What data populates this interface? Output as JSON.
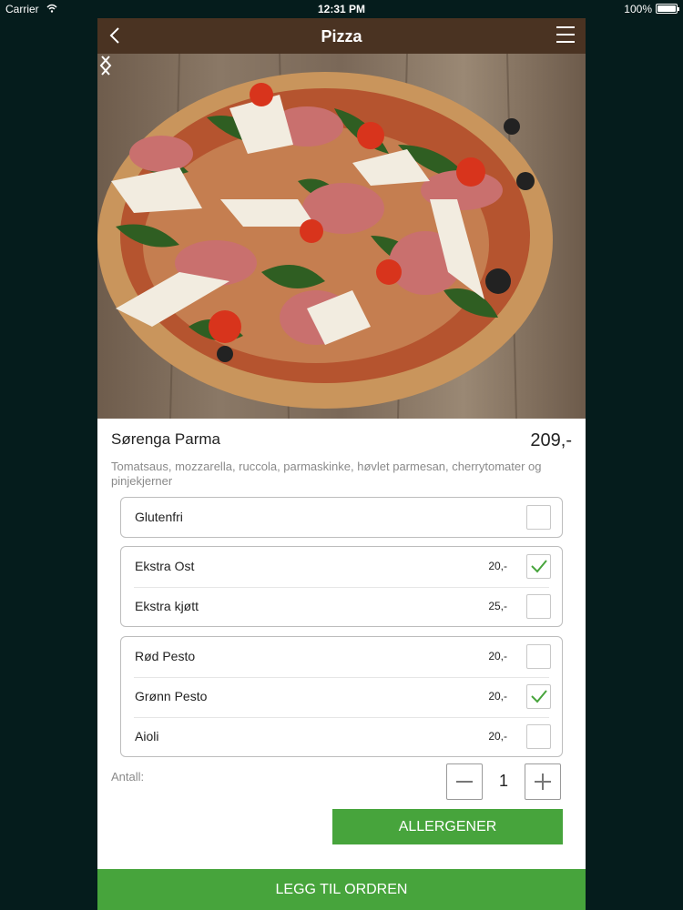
{
  "status": {
    "carrier": "Carrier",
    "time": "12:31 PM",
    "battery": "100%"
  },
  "navbar": {
    "title": "Pizza"
  },
  "product": {
    "name": "Sørenga Parma",
    "price": "209,-",
    "description": "Tomatsaus, mozzarella, ruccola, parmaskinke, høvlet parmesan, cherrytomater og pinjekjerner"
  },
  "groups": [
    {
      "options": [
        {
          "label": "Glutenfri",
          "price": "",
          "checked": false
        }
      ]
    },
    {
      "options": [
        {
          "label": "Ekstra Ost",
          "price": "20,-",
          "checked": true
        },
        {
          "label": "Ekstra kjøtt",
          "price": "25,-",
          "checked": false
        }
      ]
    },
    {
      "options": [
        {
          "label": "Rød Pesto",
          "price": "20,-",
          "checked": false
        },
        {
          "label": "Grønn Pesto",
          "price": "20,-",
          "checked": true
        },
        {
          "label": "Aioli",
          "price": "20,-",
          "checked": false
        }
      ]
    }
  ],
  "quantity": {
    "label": "Antall:",
    "value": "1"
  },
  "buttons": {
    "allergens": "ALLERGENER",
    "add_to_order": "LEGG TIL ORDREN"
  },
  "colors": {
    "navbar": "#4a3322",
    "accent": "#47a43c",
    "background": "#051c1c",
    "check": "#47a43c"
  },
  "icons": {
    "back": "chevron-left-icon",
    "menu": "hamburger-menu-icon",
    "prev": "chevron-left-icon",
    "next": "chevron-right-icon"
  }
}
